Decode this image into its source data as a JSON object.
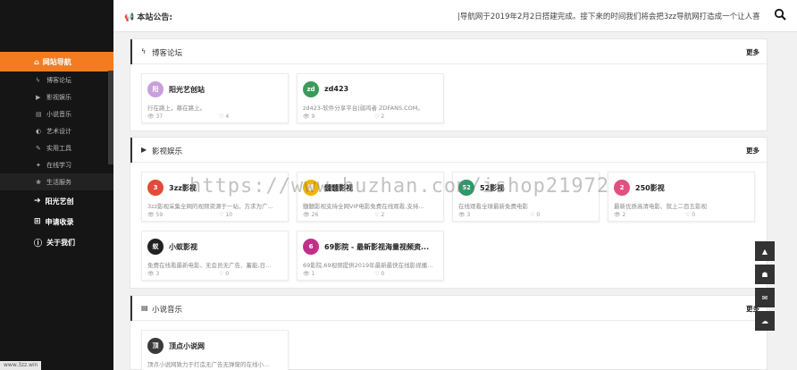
{
  "header": {
    "notice_label": "本站公告:",
    "notice_text": "|导航网于2019年2月2日搭建完成。接下来的时间我们将会把3zz导航网打造成一个让人喜"
  },
  "sidebar": {
    "active": "网站导航",
    "subitems": [
      "博客论坛",
      "影视娱乐",
      "小说音乐",
      "艺术设计",
      "实用工具",
      "在线学习",
      "生活服务"
    ],
    "main_items": [
      "阳光艺创",
      "申请收录",
      "关于我们"
    ]
  },
  "sections": [
    {
      "title": "博客论坛",
      "more": "更多",
      "cards": [
        {
          "title": "阳光艺创站",
          "desc": "行在路上，慕在路上。",
          "views": "37",
          "likes": "4",
          "color": "#c9a0dc",
          "glyph": "阳"
        },
        {
          "title": "zd423",
          "desc": "zd423-软件分享平台|弱鸡者 ZDFANS.COM。",
          "views": "9",
          "likes": "2",
          "color": "#3a9a5a",
          "glyph": "zd"
        }
      ]
    },
    {
      "title": "影视娱乐",
      "more": "更多",
      "cards": [
        {
          "title": "3zz影视",
          "desc": "3zz影视采集全网的视频资源于一站，方求为广...",
          "views": "59",
          "likes": "10",
          "color": "#e34a3a",
          "glyph": "3"
        },
        {
          "title": "髓髓影视",
          "desc": "髓髓影视支持全网VIP电影免费在线观看,支持...",
          "views": "26",
          "likes": "2",
          "color": "#f0b400",
          "glyph": "髓"
        },
        {
          "title": "52影视",
          "desc": "在线观看全球最新免费电影",
          "views": "3",
          "likes": "0",
          "color": "#2b9a6a",
          "glyph": "52"
        },
        {
          "title": "250影视",
          "desc": "最新优质高清电影、就上二百五影视",
          "views": "2",
          "likes": "0",
          "color": "#e05080",
          "glyph": "2"
        },
        {
          "title": "小蚁影视",
          "desc": "免费在线看最新电影、无会员无广告、蓄能,日...",
          "views": "3",
          "likes": "0",
          "color": "#222222",
          "glyph": "蚁"
        },
        {
          "title": "69影院 - 最新影视海量视频资...",
          "desc": "69影院,69视频提供2019年最新最快在线影视播...",
          "views": "1",
          "likes": "0",
          "color": "#c0308a",
          "glyph": "6"
        }
      ]
    },
    {
      "title": "小说音乐",
      "more": "更多",
      "cards": [
        {
          "title": "顶点小说网",
          "desc": "顶点小说网致力于打造无广告无弹窗的在线小...",
          "views": "",
          "likes": "",
          "color": "#3a3a3a",
          "glyph": "顶"
        }
      ]
    }
  ],
  "watermark": "https://www.huzhan.com/ishop21972",
  "status_url": "www.3zz.win"
}
